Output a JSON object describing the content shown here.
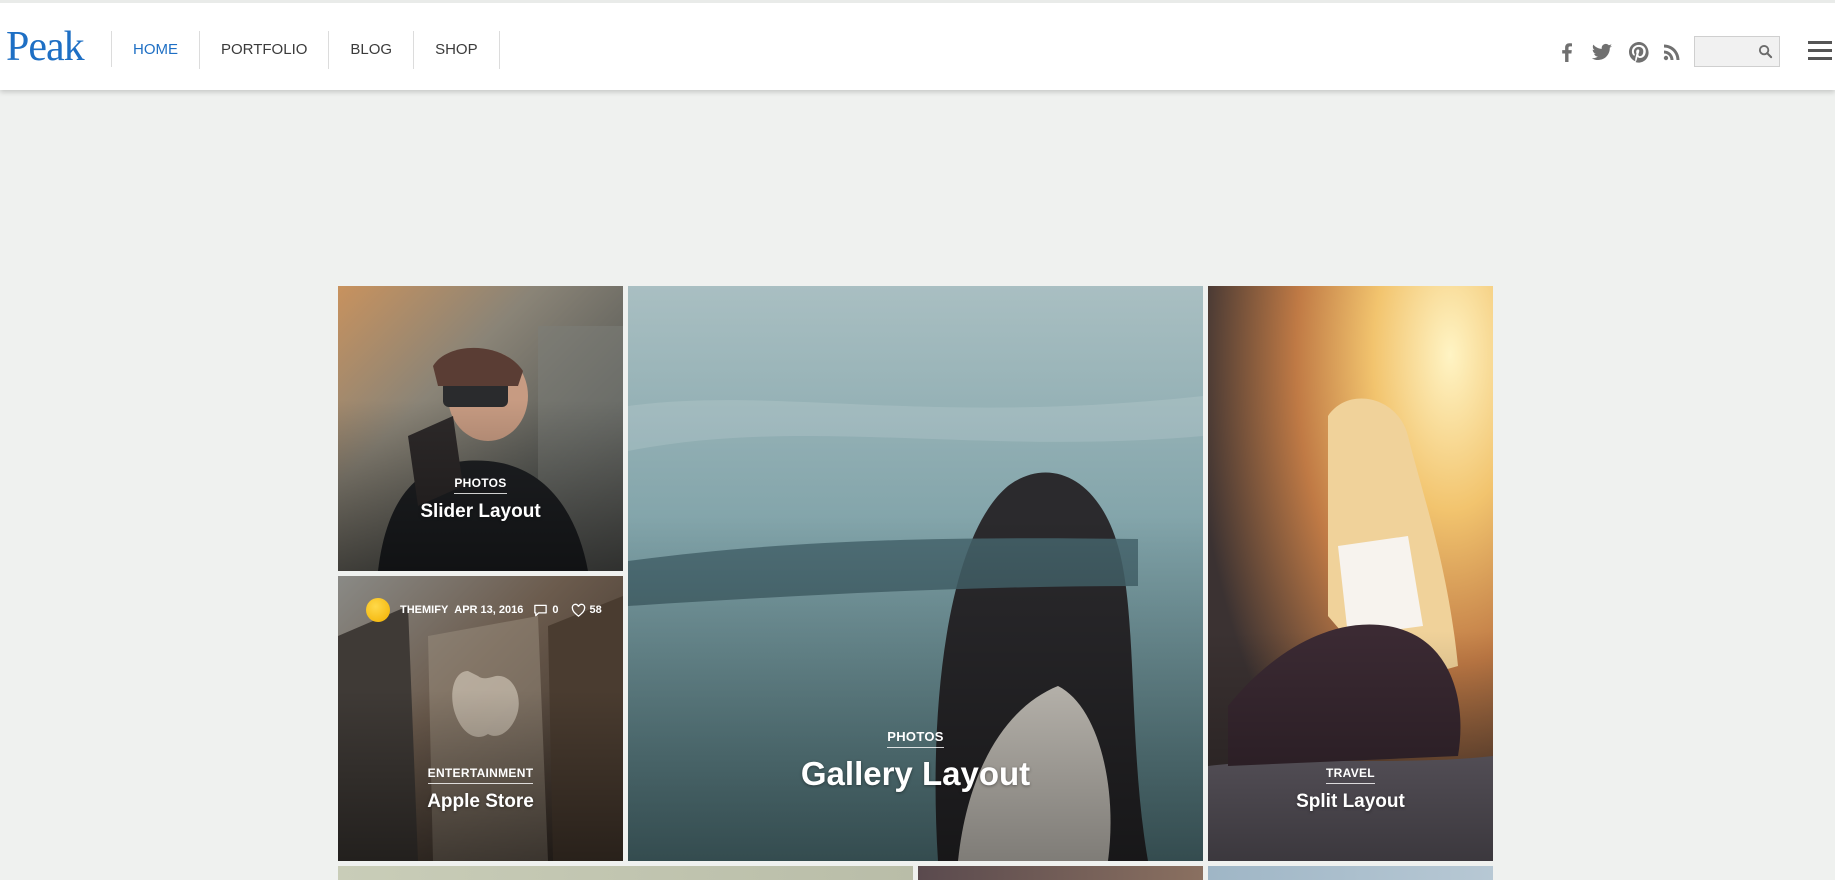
{
  "site": {
    "logo": "Peak",
    "accent_color": "#1e6fc4"
  },
  "nav": {
    "items": [
      {
        "label": "HOME",
        "active": true
      },
      {
        "label": "PORTFOLIO",
        "active": false
      },
      {
        "label": "BLOG",
        "active": false
      },
      {
        "label": "SHOP",
        "active": false
      }
    ]
  },
  "header_right": {
    "social_icons": [
      "facebook-icon",
      "twitter-icon",
      "pinterest-icon",
      "rss-icon"
    ],
    "search": {
      "value": "",
      "placeholder": ""
    },
    "menu_icon": "hamburger-menu-icon"
  },
  "posts": [
    {
      "category": "PHOTOS",
      "title": "Slider Layout"
    },
    {
      "category": "PHOTOS",
      "title": "Gallery Layout"
    },
    {
      "category": "TRAVEL",
      "title": "Split Layout"
    },
    {
      "category": "ENTERTAINMENT",
      "title": "Apple Store",
      "author": "THEMIFY",
      "date": "APR 13, 2016",
      "comments": "0",
      "likes": "58"
    }
  ]
}
